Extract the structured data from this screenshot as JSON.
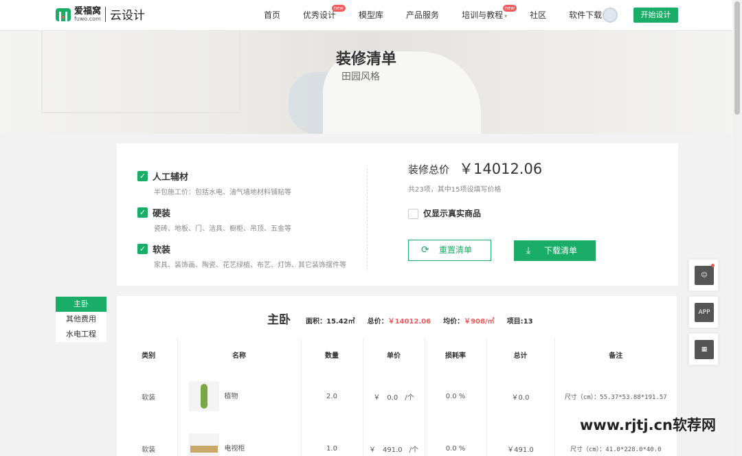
{
  "header": {
    "logo_cn": "爱福窝",
    "logo_en": "fuwo.com",
    "logo_sub": "云设计",
    "nav": [
      {
        "label": "首页",
        "badge": ""
      },
      {
        "label": "优秀设计",
        "badge": "new"
      },
      {
        "label": "模型库",
        "badge": ""
      },
      {
        "label": "产品服务",
        "badge": ""
      },
      {
        "label": "培训与教程",
        "badge": "new"
      },
      {
        "label": "社区",
        "badge": ""
      },
      {
        "label": "软件下载",
        "badge": ""
      }
    ],
    "start_button": "开始设计"
  },
  "banner": {
    "title": "装修清单",
    "subtitle": "田园风格"
  },
  "summary": {
    "options": [
      {
        "title": "人工辅材",
        "desc": "半包施工价：包括水电、油气墙地材料铺贴等",
        "checked": true
      },
      {
        "title": "硬装",
        "desc": "瓷砖、地板、门、洁具、橱柜、吊顶、五金等",
        "checked": true
      },
      {
        "title": "软装",
        "desc": "家具、装饰画、陶瓷、花艺绿植、布艺、灯饰、其它装饰摆件等",
        "checked": true
      }
    ],
    "total_label": "装修总价",
    "total_value": "￥14012.06",
    "count_text": "共23项，其中15项设填写价格",
    "real_only_label": "仅显示真实商品",
    "reset_button": "重置清单",
    "download_button": "下载清单"
  },
  "sidenav": {
    "items": [
      "主卧",
      "其他费用",
      "水电工程"
    ],
    "active": "主卧"
  },
  "room": {
    "name": "主卧",
    "area_label": "面积：",
    "area_value": "15.42㎡",
    "total_label": "总价：",
    "total_value": "￥14012.06",
    "avg_label": "均价：",
    "avg_value": "￥908/㎡",
    "items_label": "项目:",
    "items_value": "13",
    "columns": [
      "类别",
      "名称",
      "数量",
      "单价",
      "损耗率",
      "总计",
      "备注"
    ],
    "rows": [
      {
        "category": "软装",
        "name": "植物",
        "thumb": "plant",
        "qty": "2.0",
        "price": "￥　0.0　/个",
        "loss": "0.0 %",
        "total": "￥0.0",
        "note": "尺寸（cm）：55.37*53.88*191.57"
      },
      {
        "category": "软装",
        "name": "电视柜",
        "thumb": "tv-stand",
        "qty": "1.0",
        "price": "￥　491.0　/个",
        "loss": "0.0 %",
        "total": "￥491.0",
        "note": "尺寸（cm）：41.0*228.0*40.0"
      }
    ]
  },
  "float_tools": [
    "客服",
    "APP",
    "二维码"
  ],
  "watermark": "www.rjtj.cn软荐网",
  "colors": {
    "accent": "#1aad68",
    "price_red": "#f05a5a"
  }
}
